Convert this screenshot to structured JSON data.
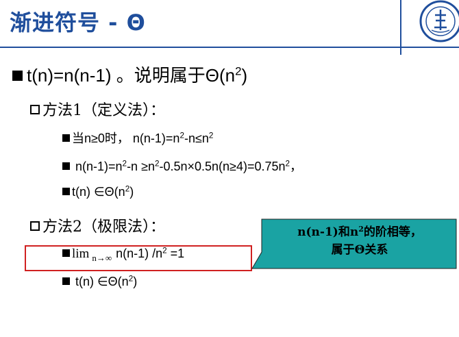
{
  "slide": {
    "title": "渐进符号 - Θ",
    "main_bullet": "t(n)=n(n-1) 。说明属于Θ(n",
    "main_bullet_sup": "2",
    "main_bullet_end": ")",
    "method1": {
      "label": "方法1（定义法）：",
      "items": [
        {
          "pre": "当n≥0时， n(n-1)=n",
          "sup": "2",
          "post": "-n≤n",
          "sup2": "2",
          "end": ""
        },
        {
          "pre": " n(n-1)=n",
          "sup": "2",
          "post": "-n ≥n",
          "sup2": "2",
          "end": "-0.5n×0.5n(n≥4)=0.75n",
          "sup3": "2",
          "tail": "，"
        },
        {
          "pre": "t(n) ∈Θ(n",
          "sup": "2",
          "post": ")"
        }
      ]
    },
    "method2": {
      "label": "方法2（极限法）：",
      "lim_word": "lim",
      "lim_sub": "n→∞",
      "lim_expr": "n(n-1) /n",
      "lim_sup": "2",
      "lim_end": " =1",
      "result_pre": " t(n) ∈Θ(n",
      "result_sup": "2",
      "result_post": ")"
    },
    "callout": {
      "line1_pre": "n(n-1)和n",
      "line1_sup": "2",
      "line1_post": "的阶相等，",
      "line2": "属于Θ关系"
    },
    "colors": {
      "title": "#1f4e9c",
      "callout_fill": "#1aa3a3",
      "highlight_border": "#d02020"
    }
  }
}
